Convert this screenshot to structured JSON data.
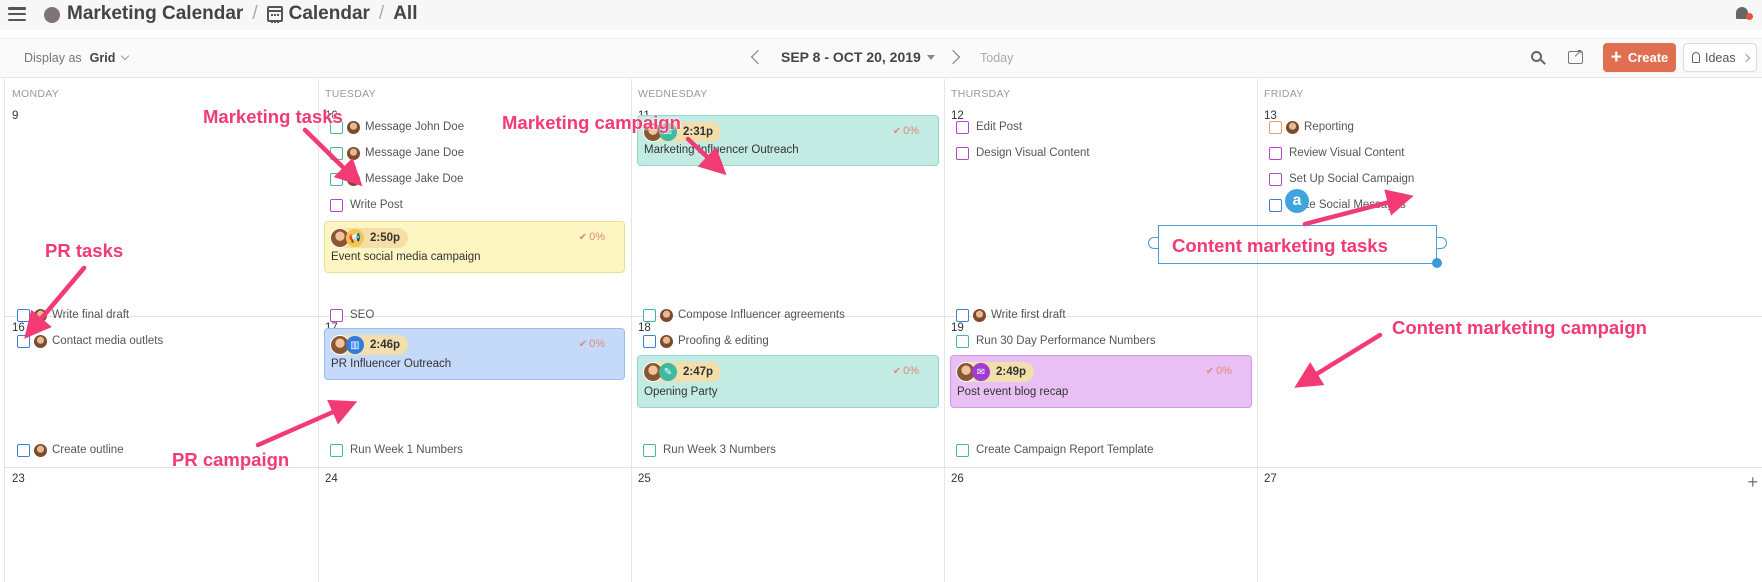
{
  "breadcrumb": {
    "workspace": "Marketing Calendar",
    "section": "Calendar",
    "view": "All"
  },
  "toolbar": {
    "display_as_label": "Display as",
    "display_as_value": "Grid",
    "date_range": "SEP 8 - OCT 20, 2019",
    "today": "Today",
    "create": "Create",
    "ideas": "Ideas",
    "create_color": "#e06e51"
  },
  "days": [
    "MONDAY",
    "TUESDAY",
    "WEDNESDAY",
    "THURSDAY",
    "FRIDAY"
  ],
  "weeks": [
    {
      "dates": [
        "9",
        "10",
        "11",
        "12",
        "13"
      ]
    },
    {
      "dates": [
        "16",
        "17",
        "18",
        "19",
        ""
      ]
    },
    {
      "dates": [
        "23",
        "24",
        "25",
        "26",
        "27"
      ]
    }
  ],
  "tasks": {
    "tue10": [
      "Message John Doe",
      "Message Jane Doe",
      "Message Jake Doe",
      "Write Post"
    ],
    "thu12": [
      "Edit Post",
      "Design Visual Content"
    ],
    "fri13": [
      "Reporting",
      "Review Visual Content",
      "Set Up Social Campaign",
      "Write Social Messages"
    ],
    "mon16": [
      "Write final draft",
      "Contact media outlets"
    ],
    "tue17": [
      "SEO"
    ],
    "wed18": [
      "Compose Influencer agreements",
      "Proofing & editing"
    ],
    "thu19": [
      "Write first draft",
      "Run 30 Day Performance Numbers"
    ],
    "mon23": [
      "Create outline"
    ],
    "tue24": [
      "Run Week 1 Numbers"
    ],
    "wed25": [
      "Run Week 3 Numbers"
    ],
    "thu26": [
      "Create Campaign Report Template"
    ]
  },
  "campaigns": {
    "marketing_influencer": {
      "time": "2:31p",
      "progress": "0%",
      "title": "Marketing Influencer Outreach",
      "color": "#c2ece3",
      "icon": "email-icon"
    },
    "event_social": {
      "time": "2:50p",
      "progress": "0%",
      "title": "Event social media campaign",
      "color": "#fdf6c3",
      "icon": "megaphone-icon"
    },
    "pr_influencer": {
      "time": "2:46p",
      "progress": "0%",
      "title": "PR Influencer Outreach",
      "color": "#c5daf8",
      "icon": "map-icon"
    },
    "opening_party": {
      "time": "2:47p",
      "progress": "0%",
      "title": "Opening Party",
      "color": "#c2ece3",
      "icon": "ticket-icon"
    },
    "post_event_blog": {
      "time": "2:49p",
      "progress": "0%",
      "title": "Post event blog recap",
      "color": "#e8c0f4",
      "icon": "email-icon"
    }
  },
  "annotations": {
    "marketing_tasks": "Marketing tasks",
    "marketing_campaign": "Marketing campaign",
    "pr_tasks": "PR tasks",
    "pr_campaign": "PR campaign",
    "content_tasks": "Content marketing tasks",
    "content_campaign": "Content marketing campaign",
    "badge": "a",
    "color": "#f23a75"
  }
}
